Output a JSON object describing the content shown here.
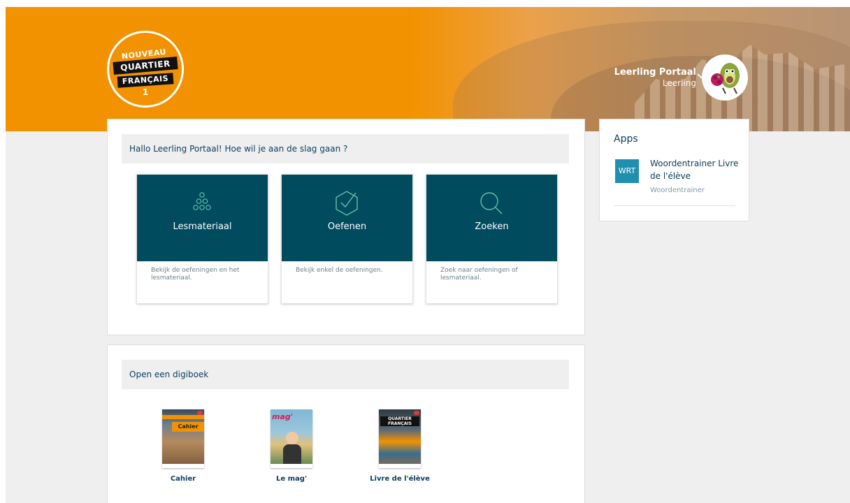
{
  "brand": {
    "logo_line1": "NOUVEAU",
    "logo_line2": "QUARTIER",
    "logo_line3": "FRANÇAIS",
    "logo_number": "1",
    "accent_color": "#f39200",
    "tile_color": "#004b5e"
  },
  "user": {
    "name": "Leerling Portaal",
    "role": "Leerling"
  },
  "main": {
    "greeting": "Hallo Leerling Portaal! Hoe wil je aan de slag gaan ?",
    "tiles": [
      {
        "title": "Lesmateriaal",
        "description": "Bekijk de oefeningen en het lesmateriaal.",
        "icon": "dots-pyramid-icon"
      },
      {
        "title": "Oefenen",
        "description": "Bekijk enkel de oefeningen.",
        "icon": "hexagon-check-icon"
      },
      {
        "title": "Zoeken",
        "description": "Zoek naar oefeningen of lesmateriaal.",
        "icon": "search-icon"
      }
    ]
  },
  "books": {
    "heading": "Open een digiboek",
    "items": [
      {
        "label": "Cahier",
        "cover_text": "Cahier"
      },
      {
        "label": "Le mag'",
        "cover_text": "mag'"
      },
      {
        "label": "Livre de l'élève",
        "cover_text": "QUARTIER FRANÇAIS"
      }
    ]
  },
  "apps": {
    "title": "Apps",
    "items": [
      {
        "badge": "WRT",
        "name": "Woordentrainer Livre de l'élève",
        "subtitle": "Woordentrainer"
      }
    ]
  }
}
